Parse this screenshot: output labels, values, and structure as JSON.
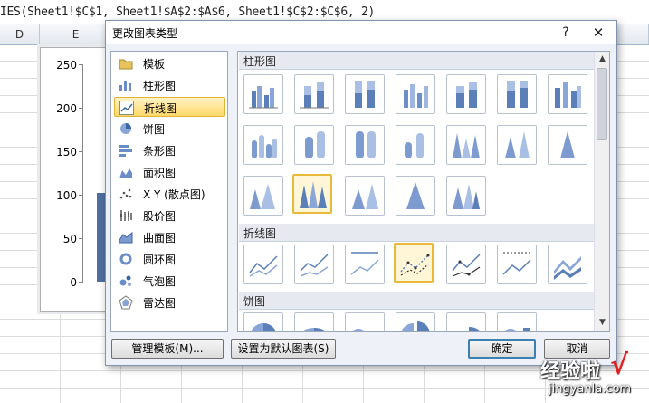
{
  "formula_bar": {
    "text": "IES(Sheet1!$C$1, Sheet1!$A$2:$A$6, Sheet1!$C$2:$C$6, 2)"
  },
  "column_headers": [
    "D",
    "E"
  ],
  "chart": {
    "ticks": [
      "250",
      "200",
      "150",
      "100",
      "50",
      "0"
    ]
  },
  "dialog": {
    "title": "更改图表类型",
    "help_label": "?",
    "close_label": "✕",
    "categories": [
      {
        "label": "模板",
        "icon": "folder-icon"
      },
      {
        "label": "柱形图",
        "icon": "column-chart-icon"
      },
      {
        "label": "折线图",
        "icon": "line-chart-icon"
      },
      {
        "label": "饼图",
        "icon": "pie-chart-icon"
      },
      {
        "label": "条形图",
        "icon": "bar-chart-icon"
      },
      {
        "label": "面积图",
        "icon": "area-chart-icon"
      },
      {
        "label": "X Y (散点图)",
        "icon": "scatter-chart-icon"
      },
      {
        "label": "股价图",
        "icon": "stock-chart-icon"
      },
      {
        "label": "曲面图",
        "icon": "surface-chart-icon"
      },
      {
        "label": "圆环图",
        "icon": "doughnut-chart-icon"
      },
      {
        "label": "气泡图",
        "icon": "bubble-chart-icon"
      },
      {
        "label": "雷达图",
        "icon": "radar-chart-icon"
      }
    ],
    "selected_category": "折线图",
    "sections": {
      "column": "柱形图",
      "line": "折线图",
      "pie": "饼图"
    },
    "buttons": {
      "manage_templates": "管理模板(M)...",
      "set_default": "设置为默认图表(S)",
      "ok": "确定",
      "cancel": "取消"
    }
  },
  "watermark": {
    "text": "经验啦",
    "check": "√",
    "url": "jingyanla.com"
  },
  "colors": {
    "accent_selected": "#ffd86a",
    "chart_bar": "#4f6fa0",
    "thumb_blue": "#5b7fb8"
  }
}
